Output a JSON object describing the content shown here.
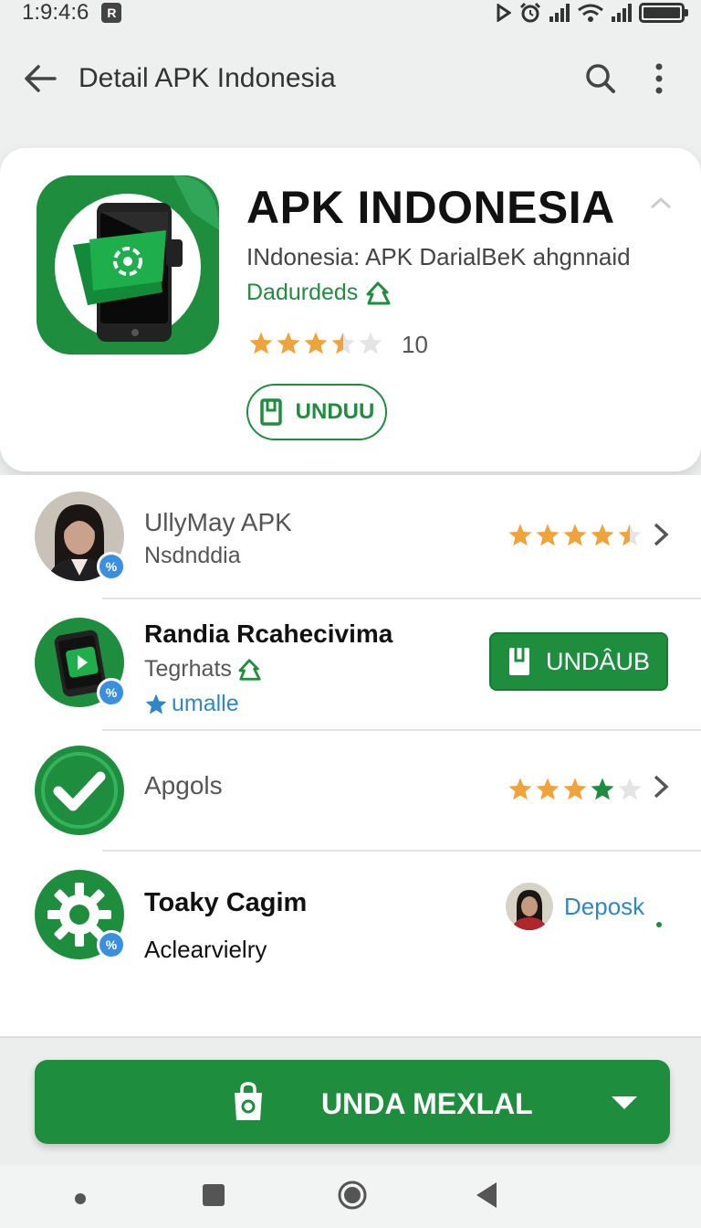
{
  "status_bar": {
    "time": "1:9:4:6",
    "badge": "R"
  },
  "app_bar": {
    "title": "Detail APK Indonesia"
  },
  "hero": {
    "title": "APK INDONESIA",
    "subtitle": "INdonesia: APK DarialBeK ahgnnaid",
    "developer": "Dadurdeds",
    "rating_count": "10",
    "rating": 3.5,
    "download_label": "UNDUU"
  },
  "list": {
    "items": [
      {
        "title": "UllyMay APK",
        "subtitle": "Nsdnddia",
        "rating": 4.5
      },
      {
        "title": "Randia Rcahecivima",
        "subtitle": "Tegrhats",
        "tag": "umalle",
        "button_label": "UNDÂUB"
      },
      {
        "title": "Apgols",
        "rating": 4
      },
      {
        "title": "Toaky Cagim",
        "subtitle": "Aclearvielry",
        "link_label": "Deposk"
      }
    ]
  },
  "primary_cta": {
    "label": "UNDA MEXLAL"
  },
  "colors": {
    "accent": "#1e8e3e",
    "star": "#f0a33a",
    "link": "#2f87c8"
  }
}
